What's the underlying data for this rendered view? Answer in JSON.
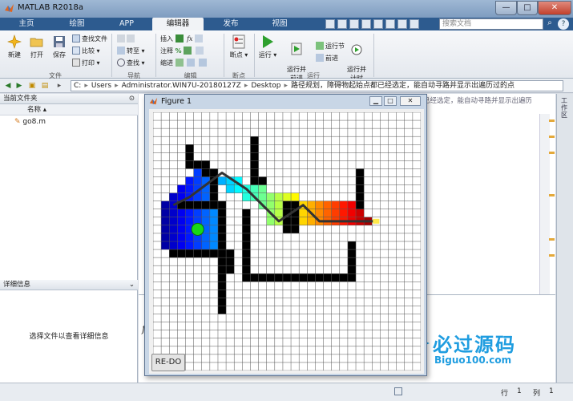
{
  "window": {
    "title": "MATLAB R2018a",
    "min_label": "—",
    "max_label": "□",
    "close_label": "✕"
  },
  "ribbon_tabs": [
    {
      "label": "主页"
    },
    {
      "label": "绘图"
    },
    {
      "label": "APP"
    },
    {
      "label": "编辑器"
    },
    {
      "label": "发布"
    },
    {
      "label": "视图"
    }
  ],
  "search": {
    "placeholder": "搜索文档"
  },
  "ribbon": {
    "file_group": {
      "label": "文件",
      "new": "新建",
      "open": "打开",
      "save": "保存",
      "find_files": "查找文件",
      "compare": "比较",
      "print": "打印"
    },
    "nav_group": {
      "label": "导航",
      "goto": "转至",
      "find": "查找"
    },
    "edit_group": {
      "label": "编辑",
      "insert": "插入",
      "comment": "注释",
      "indent": "缩进"
    },
    "breakpoint_group": {
      "label": "断点",
      "breakpoints": "断点"
    },
    "run_group": {
      "label": "运行",
      "run": "运行",
      "run_advance": "运行并\n前进",
      "run_section": "运行节",
      "advance": "前进",
      "run_time": "运行并\n计时"
    }
  },
  "address": {
    "crumbs": [
      "C:",
      "Users",
      "Administrator.WIN7U-20180127Z",
      "Desktop",
      "路径规划，障碍物起始点都已经选定，能自动寻路并显示出遍历过的点"
    ]
  },
  "file_browser": {
    "title": "当前文件夹",
    "column_name": "名称",
    "file": "go8.m"
  },
  "details": {
    "title": "详细信息",
    "placeholder": "选择文件以查看详细信息"
  },
  "editor": {
    "tab_text": "已经选定，能自动寻路并显示出遍历..."
  },
  "command_window": {
    "fx_label": "fx"
  },
  "workspace": {
    "label": "工作区"
  },
  "statusbar": {
    "row_label": "行",
    "row_value": "1",
    "col_label": "列",
    "col_value": "1"
  },
  "figure": {
    "title": "Figure 1",
    "redo_label": "RE-DO",
    "grid": {
      "cols": 33,
      "rows": 32,
      "obstacle_cells": [
        [
          4,
          4
        ],
        [
          4,
          5
        ],
        [
          4,
          6
        ],
        [
          5,
          6
        ],
        [
          6,
          6
        ],
        [
          6,
          7
        ],
        [
          7,
          7
        ],
        [
          7,
          8
        ],
        [
          7,
          9
        ],
        [
          7,
          10
        ],
        [
          12,
          3
        ],
        [
          12,
          4
        ],
        [
          12,
          5
        ],
        [
          12,
          6
        ],
        [
          12,
          7
        ],
        [
          12,
          8
        ],
        [
          13,
          8
        ],
        [
          25,
          7
        ],
        [
          25,
          8
        ],
        [
          25,
          9
        ],
        [
          25,
          10
        ],
        [
          25,
          11
        ],
        [
          3,
          11
        ],
        [
          4,
          11
        ],
        [
          5,
          11
        ],
        [
          6,
          11
        ],
        [
          7,
          11
        ],
        [
          8,
          11
        ],
        [
          8,
          12
        ],
        [
          8,
          13
        ],
        [
          8,
          14
        ],
        [
          8,
          15
        ],
        [
          8,
          16
        ],
        [
          8,
          17
        ],
        [
          8,
          18
        ],
        [
          2,
          17
        ],
        [
          3,
          17
        ],
        [
          4,
          17
        ],
        [
          5,
          17
        ],
        [
          6,
          17
        ],
        [
          7,
          17
        ],
        [
          8,
          19
        ],
        [
          8,
          20
        ],
        [
          8,
          21
        ],
        [
          8,
          22
        ],
        [
          8,
          23
        ],
        [
          8,
          24
        ],
        [
          11,
          12
        ],
        [
          11,
          13
        ],
        [
          11,
          14
        ],
        [
          11,
          15
        ],
        [
          11,
          16
        ],
        [
          11,
          17
        ],
        [
          11,
          18
        ],
        [
          11,
          19
        ],
        [
          11,
          20
        ],
        [
          12,
          20
        ],
        [
          13,
          20
        ],
        [
          14,
          20
        ],
        [
          15,
          20
        ],
        [
          16,
          20
        ],
        [
          17,
          20
        ],
        [
          18,
          20
        ],
        [
          19,
          20
        ],
        [
          20,
          20
        ],
        [
          21,
          20
        ],
        [
          22,
          20
        ],
        [
          23,
          20
        ],
        [
          24,
          20
        ],
        [
          24,
          16
        ],
        [
          24,
          17
        ],
        [
          24,
          18
        ],
        [
          24,
          19
        ],
        [
          16,
          11
        ],
        [
          16,
          12
        ],
        [
          16,
          13
        ],
        [
          16,
          14
        ],
        [
          17,
          14
        ],
        [
          17,
          11
        ],
        [
          17,
          12
        ],
        [
          17,
          13
        ],
        [
          9,
          17
        ],
        [
          9,
          18
        ],
        [
          9,
          19
        ]
      ],
      "visited_cells": [
        [
          5,
          7
        ],
        [
          6,
          7
        ],
        [
          5,
          8
        ],
        [
          6,
          8
        ],
        [
          4,
          8
        ],
        [
          3,
          9
        ],
        [
          4,
          9
        ],
        [
          5,
          9
        ],
        [
          6,
          9
        ],
        [
          2,
          10
        ],
        [
          3,
          10
        ],
        [
          4,
          10
        ],
        [
          5,
          10
        ],
        [
          6,
          10
        ],
        [
          1,
          11
        ],
        [
          2,
          11
        ],
        [
          1,
          12
        ],
        [
          2,
          12
        ],
        [
          3,
          12
        ],
        [
          4,
          12
        ],
        [
          5,
          12
        ],
        [
          6,
          12
        ],
        [
          7,
          12
        ],
        [
          1,
          13
        ],
        [
          2,
          13
        ],
        [
          3,
          13
        ],
        [
          4,
          13
        ],
        [
          5,
          13
        ],
        [
          6,
          13
        ],
        [
          7,
          13
        ],
        [
          1,
          14
        ],
        [
          2,
          14
        ],
        [
          3,
          14
        ],
        [
          4,
          14
        ],
        [
          5,
          14
        ],
        [
          6,
          14
        ],
        [
          7,
          14
        ],
        [
          1,
          15
        ],
        [
          2,
          15
        ],
        [
          3,
          15
        ],
        [
          4,
          15
        ],
        [
          5,
          15
        ],
        [
          6,
          15
        ],
        [
          7,
          15
        ],
        [
          1,
          16
        ],
        [
          2,
          16
        ],
        [
          3,
          16
        ],
        [
          4,
          16
        ],
        [
          5,
          16
        ],
        [
          6,
          16
        ],
        [
          7,
          16
        ],
        [
          8,
          8
        ],
        [
          9,
          8
        ],
        [
          10,
          8
        ],
        [
          9,
          9
        ],
        [
          10,
          9
        ],
        [
          11,
          9
        ],
        [
          12,
          9
        ],
        [
          13,
          9
        ],
        [
          11,
          10
        ],
        [
          12,
          10
        ],
        [
          13,
          10
        ],
        [
          14,
          10
        ],
        [
          15,
          10
        ],
        [
          16,
          10
        ],
        [
          13,
          11
        ],
        [
          14,
          11
        ],
        [
          15,
          11
        ],
        [
          14,
          12
        ],
        [
          15,
          12
        ],
        [
          14,
          13
        ],
        [
          15,
          13
        ],
        [
          17,
          10
        ],
        [
          18,
          11
        ],
        [
          19,
          11
        ],
        [
          20,
          11
        ],
        [
          21,
          11
        ],
        [
          22,
          11
        ],
        [
          23,
          11
        ],
        [
          24,
          11
        ],
        [
          18,
          12
        ],
        [
          19,
          12
        ],
        [
          20,
          12
        ],
        [
          21,
          12
        ],
        [
          22,
          12
        ],
        [
          23,
          12
        ],
        [
          24,
          12
        ],
        [
          25,
          12
        ],
        [
          18,
          13
        ],
        [
          19,
          13
        ],
        [
          20,
          13
        ],
        [
          21,
          13
        ],
        [
          22,
          13
        ],
        [
          23,
          13
        ],
        [
          24,
          13
        ],
        [
          25,
          13
        ],
        [
          26,
          13
        ]
      ],
      "path_points": [
        [
          2,
          11
        ],
        [
          4,
          10
        ],
        [
          8,
          7
        ],
        [
          11,
          9
        ],
        [
          15,
          13
        ],
        [
          18,
          11
        ],
        [
          20,
          13
        ],
        [
          27,
          13
        ]
      ],
      "start_cell": [
        5,
        14
      ],
      "goal_cell": [
        27,
        13
      ]
    }
  },
  "watermark": {
    "main": "必过源码",
    "sub": "Biguo100.com"
  },
  "colors": {
    "ribbon_tab_bg": "#2d5b8f",
    "obstacle": "#000000",
    "start": "#18d818",
    "path": "#333333"
  }
}
